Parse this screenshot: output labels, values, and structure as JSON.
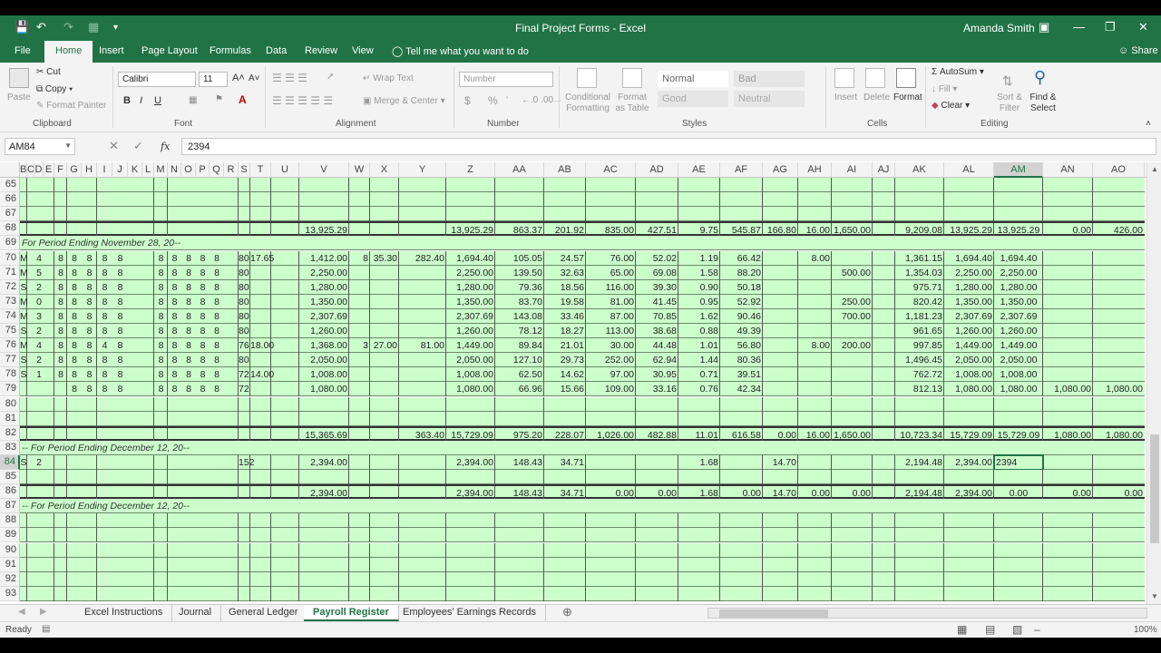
{
  "window": {
    "title": "Final Project Forms - Excel",
    "user": "Amanda Smith",
    "qa_icons": [
      "save-icon",
      "undo-icon",
      "redo-icon",
      "customize-icon"
    ],
    "controls": [
      "ribbon-options-icon",
      "minimize-icon",
      "restore-icon",
      "close-icon"
    ]
  },
  "menu": {
    "tabs": [
      "File",
      "Home",
      "Insert",
      "Page Layout",
      "Formulas",
      "Data",
      "Review",
      "View"
    ],
    "active": "Home",
    "tell_me": "Tell me what you want to do",
    "share": "Share"
  },
  "ribbon": {
    "clipboard": {
      "label": "Clipboard",
      "paste": "Paste",
      "cut": "Cut",
      "copy": "Copy",
      "format_painter": "Format Painter"
    },
    "font": {
      "label": "Font",
      "name": "Calibri",
      "size": "11",
      "bold": "B",
      "italic": "I",
      "underline": "U"
    },
    "alignment": {
      "label": "Alignment",
      "wrap": "Wrap Text",
      "merge": "Merge & Center"
    },
    "number": {
      "label": "Number",
      "format": "Number",
      "currency": "$",
      "percent": "%"
    },
    "styles": {
      "label": "Styles",
      "conditional": "Conditional Formatting",
      "format_table": "Format as Table",
      "normal": "Normal",
      "bad": "Bad",
      "good": "Good",
      "neutral": "Neutral"
    },
    "cells": {
      "label": "Cells",
      "insert": "Insert",
      "delete": "Delete",
      "format": "Format"
    },
    "editing": {
      "label": "Editing",
      "autosum": "AutoSum",
      "fill": "Fill",
      "clear": "Clear",
      "sort": "Sort & Filter",
      "find": "Find & Select"
    }
  },
  "formula_bar": {
    "name_box": "AM84",
    "value": "2394",
    "fx": "fx"
  },
  "columns": [
    "B",
    "C",
    "D",
    "E",
    "F",
    "G",
    "H",
    "I",
    "J",
    "K",
    "L",
    "M",
    "N",
    "O",
    "P",
    "Q",
    "R",
    "S",
    "T",
    "U",
    "V",
    "W",
    "X",
    "Y",
    "Z",
    "AA",
    "AB",
    "AC",
    "AD",
    "AE",
    "AF",
    "AG",
    "AH",
    "AI",
    "AJ",
    "AK",
    "AL",
    "AM",
    "AN",
    "AO"
  ],
  "selected_column": "AM",
  "selected_row": "84",
  "rows": [
    {
      "num": "65",
      "cells": {}
    },
    {
      "num": "66",
      "cells": {}
    },
    {
      "num": "67",
      "cells": {}
    },
    {
      "num": "68",
      "cells": {
        "V": "13,925.29",
        "Z": "13,925.29",
        "AA": "863.37",
        "AB": "201.92",
        "AC": "835.00",
        "AD": "427.51",
        "AE": "9.75",
        "AF": "545.87",
        "AG": "166.80",
        "AH": "16.00",
        "AI": "1,650.00",
        "AK": "9,209.08",
        "AL": "13,925.29",
        "AM": "13,925.29",
        "AN": "0.00",
        "AO": "426.00"
      }
    },
    {
      "num": "69",
      "label": "For Period Ending November 28, 20--"
    },
    {
      "num": "70",
      "cells": {
        "B": "M",
        "D": "4",
        "F": "8",
        "G": "8",
        "H": "8",
        "I": "8",
        "J": "8",
        "M": "8",
        "N": "8",
        "O": "8",
        "P": "8",
        "Q": "8",
        "S": "80",
        "T": "17.65",
        "V": "1,412.00",
        "W": "8",
        "X": "35.30",
        "Y": "282.40",
        "Z": "1,694.40",
        "AA": "105.05",
        "AB": "24.57",
        "AC": "76.00",
        "AD": "52.02",
        "AE": "1.19",
        "AF": "66.42",
        "AH": "8.00",
        "AK": "1,361.15",
        "AL": "1,694.40",
        "AM": "1,694.40"
      }
    },
    {
      "num": "71",
      "cells": {
        "B": "M",
        "D": "5",
        "F": "8",
        "G": "8",
        "H": "8",
        "I": "8",
        "J": "8",
        "M": "8",
        "N": "8",
        "O": "8",
        "P": "8",
        "Q": "8",
        "S": "80",
        "V": "2,250.00",
        "Z": "2,250.00",
        "AA": "139.50",
        "AB": "32.63",
        "AC": "65.00",
        "AD": "69.08",
        "AE": "1.58",
        "AF": "88.20",
        "AI": "500.00",
        "AK": "1,354.03",
        "AL": "2,250.00",
        "AM": "2,250.00"
      }
    },
    {
      "num": "72",
      "cells": {
        "B": "S",
        "D": "2",
        "F": "8",
        "G": "8",
        "H": "8",
        "I": "8",
        "J": "8",
        "M": "8",
        "N": "8",
        "O": "8",
        "P": "8",
        "Q": "8",
        "S": "80",
        "V": "1,280.00",
        "Z": "1,280.00",
        "AA": "79.36",
        "AB": "18.56",
        "AC": "116.00",
        "AD": "39.30",
        "AE": "0.90",
        "AF": "50.18",
        "AK": "975.71",
        "AL": "1,280.00",
        "AM": "1,280.00"
      }
    },
    {
      "num": "73",
      "cells": {
        "B": "M",
        "D": "0",
        "F": "8",
        "G": "8",
        "H": "8",
        "I": "8",
        "J": "8",
        "M": "8",
        "N": "8",
        "O": "8",
        "P": "8",
        "Q": "8",
        "S": "80",
        "V": "1,350.00",
        "Z": "1,350.00",
        "AA": "83.70",
        "AB": "19.58",
        "AC": "81.00",
        "AD": "41.45",
        "AE": "0.95",
        "AF": "52.92",
        "AI": "250.00",
        "AK": "820.42",
        "AL": "1,350.00",
        "AM": "1,350.00"
      }
    },
    {
      "num": "74",
      "cells": {
        "B": "M",
        "D": "3",
        "F": "8",
        "G": "8",
        "H": "8",
        "I": "8",
        "J": "8",
        "M": "8",
        "N": "8",
        "O": "8",
        "P": "8",
        "Q": "8",
        "S": "80",
        "V": "2,307.69",
        "Z": "2,307.69",
        "AA": "143.08",
        "AB": "33.46",
        "AC": "87.00",
        "AD": "70.85",
        "AE": "1.62",
        "AF": "90.46",
        "AI": "700.00",
        "AK": "1,181.23",
        "AL": "2,307.69",
        "AM": "2,307.69"
      }
    },
    {
      "num": "75",
      "cells": {
        "B": "S",
        "D": "2",
        "F": "8",
        "G": "8",
        "H": "8",
        "I": "8",
        "J": "8",
        "M": "8",
        "N": "8",
        "O": "8",
        "P": "8",
        "Q": "8",
        "S": "80",
        "V": "1,260.00",
        "Z": "1,260.00",
        "AA": "78.12",
        "AB": "18.27",
        "AC": "113.00",
        "AD": "38.68",
        "AE": "0.88",
        "AF": "49.39",
        "AK": "961.65",
        "AL": "1,260.00",
        "AM": "1,260.00"
      }
    },
    {
      "num": "76",
      "cells": {
        "B": "M",
        "D": "4",
        "F": "8",
        "G": "8",
        "H": "8",
        "I": "4",
        "J": "8",
        "M": "8",
        "N": "8",
        "O": "8",
        "P": "8",
        "Q": "8",
        "S": "76",
        "T": "18.00",
        "V": "1,368.00",
        "W": "3",
        "X": "27.00",
        "Y": "81.00",
        "Z": "1,449.00",
        "AA": "89.84",
        "AB": "21.01",
        "AC": "30.00",
        "AD": "44.48",
        "AE": "1.01",
        "AF": "56.80",
        "AH": "8.00",
        "AI": "200.00",
        "AK": "997.85",
        "AL": "1,449.00",
        "AM": "1,449.00"
      }
    },
    {
      "num": "77",
      "cells": {
        "B": "S",
        "D": "2",
        "F": "8",
        "G": "8",
        "H": "8",
        "I": "8",
        "J": "8",
        "M": "8",
        "N": "8",
        "O": "8",
        "P": "8",
        "Q": "8",
        "S": "80",
        "V": "2,050.00",
        "Z": "2,050.00",
        "AA": "127.10",
        "AB": "29.73",
        "AC": "252.00",
        "AD": "62.94",
        "AE": "1.44",
        "AF": "80.36",
        "AK": "1,496.45",
        "AL": "2,050.00",
        "AM": "2,050.00"
      }
    },
    {
      "num": "78",
      "cells": {
        "B": "S",
        "D": "1",
        "F": "8",
        "G": "8",
        "H": "8",
        "I": "8",
        "J": "8",
        "M": "8",
        "N": "8",
        "O": "8",
        "P": "8",
        "Q": "8",
        "S": "72",
        "T": "14.00",
        "V": "1,008.00",
        "Z": "1,008.00",
        "AA": "62.50",
        "AB": "14.62",
        "AC": "97.00",
        "AD": "30.95",
        "AE": "0.71",
        "AF": "39.51",
        "AK": "762.72",
        "AL": "1,008.00",
        "AM": "1,008.00"
      }
    },
    {
      "num": "79",
      "cells": {
        "G": "8",
        "H": "8",
        "I": "8",
        "J": "8",
        "M": "8",
        "N": "8",
        "O": "8",
        "P": "8",
        "Q": "8",
        "S": "72",
        "V": "1,080.00",
        "Z": "1,080.00",
        "AA": "66.96",
        "AB": "15.66",
        "AC": "109.00",
        "AD": "33.16",
        "AE": "0.76",
        "AF": "42.34",
        "AK": "812.13",
        "AL": "1,080.00",
        "AM": "1,080.00",
        "AN": "1,080.00",
        "AO": "1,080.00"
      }
    },
    {
      "num": "80",
      "cells": {}
    },
    {
      "num": "81",
      "cells": {}
    },
    {
      "num": "82",
      "cells": {
        "V": "15,365.69",
        "Y": "363.40",
        "Z": "15,729.09",
        "AA": "975.20",
        "AB": "228.07",
        "AC": "1,026.00",
        "AD": "482.88",
        "AE": "11.01",
        "AF": "616.58",
        "AG": "0.00",
        "AH": "16.00",
        "AI": "1,650.00",
        "AK": "10,723.34",
        "AL": "15,729.09",
        "AM": "15,729.09",
        "AN": "1,080.00",
        "AO": "1,080.00"
      }
    },
    {
      "num": "83",
      "label": "-- For Period Ending December 12, 20--"
    },
    {
      "num": "84",
      "cells": {
        "B": "S",
        "D": "2",
        "S": "152",
        "V": "2,394.00",
        "Z": "2,394.00",
        "AA": "148.43",
        "AB": "34.71",
        "AE": "1.68",
        "AG": "14.70",
        "AK": "2,194.48",
        "AL": "2,394.00",
        "AM": "2394"
      }
    },
    {
      "num": "85",
      "cells": {}
    },
    {
      "num": "86",
      "cells": {
        "V": "2,394.00",
        "Z": "2,394.00",
        "AA": "148.43",
        "AB": "34.71",
        "AC": "0.00",
        "AD": "0.00",
        "AE": "1.68",
        "AF": "0.00",
        "AG": "14.70",
        "AH": "0.00",
        "AI": "0.00",
        "AK": "2,194.48",
        "AL": "2,394.00",
        "AM": "0.00",
        "AN": "0.00",
        "AO": "0.00"
      }
    },
    {
      "num": "87",
      "label": "-- For Period Ending December 12, 20--"
    },
    {
      "num": "88",
      "cells": {}
    },
    {
      "num": "89",
      "cells": {}
    },
    {
      "num": "90",
      "cells": {}
    },
    {
      "num": "91",
      "cells": {}
    },
    {
      "num": "92",
      "cells": {}
    },
    {
      "num": "93",
      "cells": {}
    }
  ],
  "sheets": [
    "Excel Instructions",
    "Journal",
    "General Ledger",
    "Payroll Register",
    "Employees' Earnings Records"
  ],
  "active_sheet": "Payroll Register",
  "status": {
    "ready": "Ready",
    "zoom": "100%"
  }
}
